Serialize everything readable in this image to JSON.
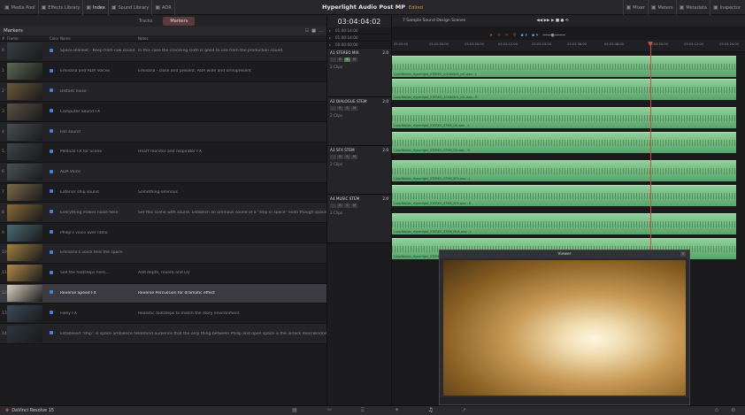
{
  "topbar": {
    "left": [
      {
        "icon": "media-pool-icon",
        "label": "Media Pool"
      },
      {
        "icon": "effects-icon",
        "label": "Effects Library"
      },
      {
        "icon": "index-icon",
        "label": "Index"
      },
      {
        "icon": "sound-library-icon",
        "label": "Sound Library"
      },
      {
        "icon": "adr-icon",
        "label": "ADR"
      }
    ],
    "title": "Hyperlight Audio Post MP",
    "status": "Edited",
    "right": [
      {
        "icon": "mixer-icon",
        "label": "Mixer"
      },
      {
        "icon": "meters-icon",
        "label": "Meters"
      },
      {
        "icon": "metadata-icon",
        "label": "Metadata"
      },
      {
        "icon": "inspector-icon",
        "label": "Inspector"
      }
    ]
  },
  "left_panel": {
    "tabs": [
      "Tracks",
      "Markers"
    ],
    "section": "Markers",
    "columns": {
      "num": "#",
      "frame": "Frame",
      "color": "Color",
      "name": "Name",
      "notes": "Notes"
    },
    "rows": [
      {
        "n": "0",
        "name": "Space Blanket - Keep from raw sound",
        "notes": "In this case the crackling cloth is good to use from the production sound.",
        "t": "#3a3f44"
      },
      {
        "n": "1",
        "name": "Emiliana and ADA Voices",
        "notes": "Emiliana - close and present, ADA wide and omnipresent",
        "t": "#5b6a54"
      },
      {
        "n": "2",
        "name": "Distant noise",
        "notes": "",
        "t": "#6a5a3a"
      },
      {
        "n": "3",
        "name": "Computer Sound FX",
        "notes": "",
        "t": "#5a5044"
      },
      {
        "n": "4",
        "name": "Fan sound",
        "notes": "",
        "t": "#4a4e52"
      },
      {
        "n": "5",
        "name": "Medical FX for Scene",
        "notes": "Heart monitor and respirator FX",
        "t": "#3e4448"
      },
      {
        "n": "6",
        "name": "ADA Voice",
        "notes": "",
        "t": "#4a5258"
      },
      {
        "n": "7",
        "name": "Exterior ship sound",
        "notes": "Something ominous",
        "t": "#7a6a4a"
      },
      {
        "n": "8",
        "name": "Everything makes noise here",
        "notes": "Set this scene with sound. Establish an ominous sound of a \"ship in space\" even though space is a vacuum.",
        "t": "#8a6a3a"
      },
      {
        "n": "9",
        "name": "Philip's voice over radio",
        "notes": "",
        "t": "#4a6a74"
      },
      {
        "n": "10",
        "name": "Emiliana's voice tells the space",
        "notes": "",
        "t": "#a08040"
      },
      {
        "n": "11",
        "name": "Sell the footsteps here...",
        "notes": "Add depth, reverb and EQ",
        "t": "#b08a4a"
      },
      {
        "n": "12",
        "name": "Reverse Speed FX",
        "notes": "Reverse Percussion for dramatic effect",
        "t": "#d8d0c0",
        "sel": true
      },
      {
        "n": "13",
        "name": "Foley FX",
        "notes": "Realistic footsteps to match the story environment",
        "t": "#3a4a5a"
      },
      {
        "n": "14",
        "name": "Establised \"ship\" in space ambience here",
        "notes": "Remind audience that the only thing between Philip and open space is the airlock door/window.",
        "t": "#2e3640"
      }
    ]
  },
  "timecode": "03:04:04:02",
  "tc_rows": [
    "01:00:14:00",
    "01:00:14:00",
    "00:00:00:00"
  ],
  "tracks": [
    {
      "id": "A1",
      "name": "STEREO MIX",
      "ch": "2.0",
      "clips": "2 Clips"
    },
    {
      "id": "A2",
      "name": "DIALOGUE STEM",
      "ch": "2.0",
      "clips": "2 Clips"
    },
    {
      "id": "A3",
      "name": "SFX STEM",
      "ch": "2.0",
      "clips": "2 Clips"
    },
    {
      "id": "A4",
      "name": "MUSIC STEM",
      "ch": "2.0",
      "clips": "2 Clips"
    }
  ],
  "timeline": {
    "name": "7 Sample Sound Design Scenes",
    "ruler": [
      "03:00:00",
      "03:02:00:00",
      "03:03:00:00",
      "03:03:12:00",
      "03:03:24:00",
      "03:03:36:00",
      "03:03:48:00",
      "03:04:00:00",
      "03:04:12:00",
      "03:04:24:00"
    ],
    "clips": [
      "ColorNation_Hyperlight_STEREO_20180501_mC.wav - L",
      "ColorNation_Hyperlight_STEREO_20180501_mC.wav - R",
      "ColorNation_Hyperlight_STEREO_STEM_DX.wav - L",
      "ColorNation_Hyperlight_STEREO_STEM_DX.wav - R",
      "ColorNation_Hyperlight_STEREO_STEM_SFX.wav - L",
      "ColorNation_Hyperlight_STEREO_STEM_SFX.wav - R",
      "ColorNation_Hyperlight_STEREO_STEM_MUS.wav - L",
      "ColorNation_Hyperlight_STEREO_STEM_MUS.wav - R"
    ]
  },
  "viewer": {
    "title": "Viewer"
  },
  "statusbar": {
    "app": "DaVinci Resolve 15"
  }
}
